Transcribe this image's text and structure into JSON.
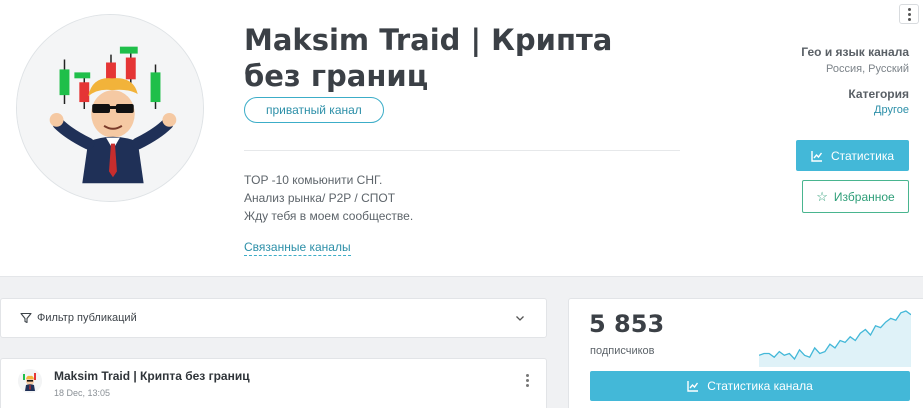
{
  "channel": {
    "title": "Maksim Traid | Крипта без границ",
    "badge": "приватный канал",
    "description": [
      "TOP -10 комьюнити СНГ.",
      "Анализ рынка/ P2P / СПОТ",
      "Жду тебя в моем сообществе."
    ],
    "related_link": "Связанные каналы",
    "avatar_icon": "trader-mascot-avatar"
  },
  "sidebar_meta": {
    "geo_label": "Гео и язык канала",
    "geo_value": "Россия, Русский",
    "category_label": "Категория",
    "category_value": "Другое"
  },
  "actions": {
    "stats_button": "Статистика",
    "favorite_button": "Избранное"
  },
  "filter": {
    "label": "Фильтр публикаций"
  },
  "post": {
    "channel_name": "Maksim Traid | Крипта без границ",
    "date": "18 Dec, 13:05"
  },
  "stats": {
    "subscribers": "5 853",
    "subscribers_label": "подписчиков",
    "channel_stats_button": "Статистика канала",
    "sparkline": [
      8,
      9,
      9,
      7,
      10,
      8,
      9,
      6,
      11,
      8,
      7,
      12,
      9,
      10,
      14,
      12,
      16,
      15,
      18,
      16,
      20,
      22,
      19,
      24,
      23,
      26,
      28,
      27,
      31,
      32,
      30
    ],
    "accent_color": "#43b8d8"
  },
  "colors": {
    "brand": "#43b8d8",
    "link": "#2c8fa8",
    "favorite": "#2e9e78"
  }
}
